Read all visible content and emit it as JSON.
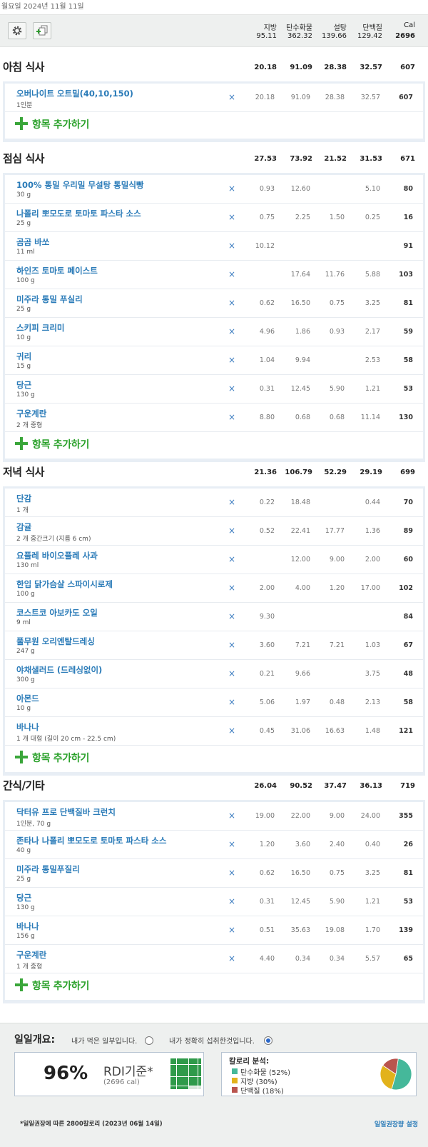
{
  "date": "월요일 2024년 11월 11일",
  "header": {
    "labels": {
      "fat": "지방",
      "carb": "탄수화물",
      "sugar": "설탕",
      "protein": "단백질",
      "cal": "Cal"
    },
    "totals": {
      "fat": "95.11",
      "carb": "362.32",
      "sugar": "139.66",
      "protein": "129.42",
      "cal": "2696"
    },
    "settings_icon": "gear-icon",
    "add_copy_icon": "add-copy-icon"
  },
  "meals": [
    {
      "name": "아침 식사",
      "totals": {
        "fat": "20.18",
        "carb": "91.09",
        "sugar": "28.38",
        "protein": "32.57",
        "cal": "607"
      },
      "items": [
        {
          "name": "오버나이트 오트밀(40,10,150)",
          "serving": "1인분",
          "fat": "20.18",
          "carb": "91.09",
          "sugar": "28.38",
          "protein": "32.57",
          "cal": "607"
        }
      ]
    },
    {
      "name": "점심 식사",
      "totals": {
        "fat": "27.53",
        "carb": "73.92",
        "sugar": "21.52",
        "protein": "31.53",
        "cal": "671"
      },
      "items": [
        {
          "name": "100% 통밀 우리밀 무설탕 통밀식빵",
          "serving": "30 g",
          "fat": "0.93",
          "carb": "12.60",
          "sugar": "",
          "protein": "5.10",
          "cal": "80"
        },
        {
          "name": "나폴리 뽀모도로 토마토 파스타 소스",
          "serving": "25 g",
          "fat": "0.75",
          "carb": "2.25",
          "sugar": "1.50",
          "protein": "0.25",
          "cal": "16"
        },
        {
          "name": "곰곰 바쏘",
          "serving": "11 ml",
          "fat": "10.12",
          "carb": "",
          "sugar": "",
          "protein": "",
          "cal": "91"
        },
        {
          "name": "하인즈 토마토 페이스트",
          "serving": "100 g",
          "fat": "",
          "carb": "17.64",
          "sugar": "11.76",
          "protein": "5.88",
          "cal": "103"
        },
        {
          "name": "미주라 통밀 푸실리",
          "serving": "25 g",
          "fat": "0.62",
          "carb": "16.50",
          "sugar": "0.75",
          "protein": "3.25",
          "cal": "81"
        },
        {
          "name": "스키피 크리미",
          "serving": "10 g",
          "fat": "4.96",
          "carb": "1.86",
          "sugar": "0.93",
          "protein": "2.17",
          "cal": "59"
        },
        {
          "name": "귀리",
          "serving": "15 g",
          "fat": "1.04",
          "carb": "9.94",
          "sugar": "",
          "protein": "2.53",
          "cal": "58"
        },
        {
          "name": "당근",
          "serving": "130 g",
          "fat": "0.31",
          "carb": "12.45",
          "sugar": "5.90",
          "protein": "1.21",
          "cal": "53"
        },
        {
          "name": "구운계란",
          "serving": "2 개 중형",
          "fat": "8.80",
          "carb": "0.68",
          "sugar": "0.68",
          "protein": "11.14",
          "cal": "130"
        }
      ]
    },
    {
      "name": "저녁 식사",
      "totals": {
        "fat": "21.36",
        "carb": "106.79",
        "sugar": "52.29",
        "protein": "29.19",
        "cal": "699"
      },
      "items": [
        {
          "name": "단감",
          "serving": "1 개",
          "fat": "0.22",
          "carb": "18.48",
          "sugar": "",
          "protein": "0.44",
          "cal": "70"
        },
        {
          "name": "감귤",
          "serving": "2 개 중간크기 (지름 6 cm)",
          "fat": "0.52",
          "carb": "22.41",
          "sugar": "17.77",
          "protein": "1.36",
          "cal": "89"
        },
        {
          "name": "요플레 바이오플레 사과",
          "serving": "130 ml",
          "fat": "",
          "carb": "12.00",
          "sugar": "9.00",
          "protein": "2.00",
          "cal": "60"
        },
        {
          "name": "한입 닭가슴살 스파이시로제",
          "serving": "100 g",
          "fat": "2.00",
          "carb": "4.00",
          "sugar": "1.20",
          "protein": "17.00",
          "cal": "102"
        },
        {
          "name": "코스트코 아보카도 오일",
          "serving": "9 ml",
          "fat": "9.30",
          "carb": "",
          "sugar": "",
          "protein": "",
          "cal": "84"
        },
        {
          "name": "풀무원 오리엔탈드레싱",
          "serving": "247 g",
          "fat": "3.60",
          "carb": "7.21",
          "sugar": "7.21",
          "protein": "1.03",
          "cal": "67"
        },
        {
          "name": "야채샐러드 (드레싱없이)",
          "serving": "300 g",
          "fat": "0.21",
          "carb": "9.66",
          "sugar": "",
          "protein": "3.75",
          "cal": "48"
        },
        {
          "name": "아몬드",
          "serving": "10 g",
          "fat": "5.06",
          "carb": "1.97",
          "sugar": "0.48",
          "protein": "2.13",
          "cal": "58"
        },
        {
          "name": "바나나",
          "serving": "1 개 대형 (길이 20 cm - 22.5 cm)",
          "fat": "0.45",
          "carb": "31.06",
          "sugar": "16.63",
          "protein": "1.48",
          "cal": "121"
        }
      ]
    },
    {
      "name": "간식/기타",
      "totals": {
        "fat": "26.04",
        "carb": "90.52",
        "sugar": "37.47",
        "protein": "36.13",
        "cal": "719"
      },
      "items": [
        {
          "name": "닥터유 프로 단백질바 크런치",
          "serving": "1인분, 70 g",
          "fat": "19.00",
          "carb": "22.00",
          "sugar": "9.00",
          "protein": "24.00",
          "cal": "355"
        },
        {
          "name": "존타나 나폴리 뽀모도로 토마토 파스타 소스",
          "serving": "40 g",
          "fat": "1.20",
          "carb": "3.60",
          "sugar": "2.40",
          "protein": "0.40",
          "cal": "26"
        },
        {
          "name": "미주라 통밀푸질리",
          "serving": "25 g",
          "fat": "0.62",
          "carb": "16.50",
          "sugar": "0.75",
          "protein": "3.25",
          "cal": "81"
        },
        {
          "name": "당근",
          "serving": "130 g",
          "fat": "0.31",
          "carb": "12.45",
          "sugar": "5.90",
          "protein": "1.21",
          "cal": "53"
        },
        {
          "name": "바나나",
          "serving": "156 g",
          "fat": "0.51",
          "carb": "35.63",
          "sugar": "19.08",
          "protein": "1.70",
          "cal": "139"
        },
        {
          "name": "구운계란",
          "serving": "1 개 중형",
          "fat": "4.40",
          "carb": "0.34",
          "sugar": "0.34",
          "protein": "5.57",
          "cal": "65"
        }
      ]
    }
  ],
  "add_item_label": "항목 추가하기",
  "delete_symbol": "×",
  "summary": {
    "title": "일일개요:",
    "option1": "내가 먹은 일부입니다.",
    "option2": "내가 정확히 섭취한것입니다.",
    "selected_option": 2,
    "rdi_percent": "96%",
    "rdi_label": "RDI기준*",
    "rdi_sub": "(2696 cal)",
    "rdi_fraction": 0.96,
    "breakdown_title": "칼로리 분석:",
    "breakdown": [
      {
        "label": "탄수화물 (52%)",
        "value": 52,
        "color": "#45b89a"
      },
      {
        "label": "지방 (30%)",
        "value": 30,
        "color": "#e2b21b"
      },
      {
        "label": "단백질 (18%)",
        "value": 18,
        "color": "#b9544e"
      }
    ],
    "footnote": "*일일권장에 따른 2800칼로리 (2023년 06월 14일)",
    "settings_link": "일일권장량 설정"
  }
}
